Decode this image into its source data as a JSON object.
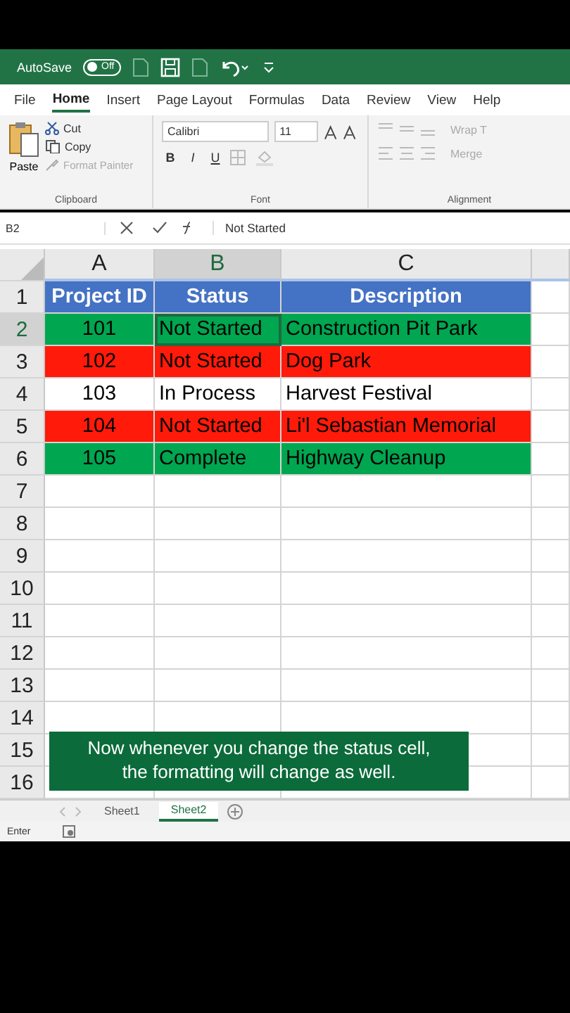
{
  "title_bar": {
    "autosave_label": "AutoSave",
    "toggle": {
      "label": "Off",
      "on": false
    }
  },
  "menu_tabs": [
    {
      "label": "File",
      "selected": false
    },
    {
      "label": "Home",
      "selected": true
    },
    {
      "label": "Insert",
      "selected": false
    },
    {
      "label": "Page Layout",
      "selected": false
    },
    {
      "label": "Formulas",
      "selected": false
    },
    {
      "label": "Data",
      "selected": false
    },
    {
      "label": "Review",
      "selected": false
    },
    {
      "label": "View",
      "selected": false
    },
    {
      "label": "Help",
      "selected": false
    }
  ],
  "ribbon": {
    "clipboard": {
      "paste": "Paste",
      "cut": "Cut",
      "copy": "Copy",
      "format_painter": "Format Painter",
      "group": "Clipboard"
    },
    "font": {
      "family": "Calibri",
      "size": "11",
      "bold": "B",
      "italic": "I",
      "underline": "U",
      "group": "Font"
    },
    "alignment": {
      "wrap": "Wrap T",
      "merge": "Merge",
      "group": "Alignment"
    }
  },
  "formula_bar": {
    "name_box": "B2",
    "content": "Not Started"
  },
  "columns": [
    {
      "label": "A",
      "selected": false
    },
    {
      "label": "B",
      "selected": true
    },
    {
      "label": "C",
      "selected": false
    }
  ],
  "rows": [
    {
      "number": "1",
      "selected": false,
      "kind": "header",
      "color": "#4472c4",
      "cells": [
        {
          "text": "Project ID",
          "selected": false
        },
        {
          "text": "Status",
          "selected": false
        },
        {
          "text": "Description",
          "selected": false
        }
      ]
    },
    {
      "number": "2",
      "selected": true,
      "kind": "data",
      "color": "#00a650",
      "cells": [
        {
          "text": "101",
          "selected": false
        },
        {
          "text": "Not Started",
          "selected": true
        },
        {
          "text": "Construction Pit Park",
          "selected": false
        }
      ]
    },
    {
      "number": "3",
      "selected": false,
      "kind": "data",
      "color": "#ff1a0a",
      "cells": [
        {
          "text": "102",
          "selected": false
        },
        {
          "text": "Not Started",
          "selected": false
        },
        {
          "text": "Dog Park",
          "selected": false
        }
      ]
    },
    {
      "number": "4",
      "selected": false,
      "kind": "data",
      "color": "#ffffff",
      "cells": [
        {
          "text": "103",
          "selected": false
        },
        {
          "text": "In Process",
          "selected": false
        },
        {
          "text": "Harvest Festival",
          "selected": false
        }
      ]
    },
    {
      "number": "5",
      "selected": false,
      "kind": "data",
      "color": "#ff1a0a",
      "cells": [
        {
          "text": "104",
          "selected": false
        },
        {
          "text": "Not Started",
          "selected": false
        },
        {
          "text": "Li'l Sebastian Memorial",
          "selected": false
        }
      ]
    },
    {
      "number": "6",
      "selected": false,
      "kind": "data",
      "color": "#00a650",
      "cells": [
        {
          "text": "105",
          "selected": false
        },
        {
          "text": "Complete",
          "selected": false
        },
        {
          "text": "Highway Cleanup",
          "selected": false
        }
      ]
    },
    {
      "number": "7"
    },
    {
      "number": "8"
    },
    {
      "number": "9"
    },
    {
      "number": "10"
    },
    {
      "number": "11"
    },
    {
      "number": "12"
    },
    {
      "number": "13"
    },
    {
      "number": "14"
    },
    {
      "number": "15"
    },
    {
      "number": "16"
    }
  ],
  "caption": "Now whenever you change the status cell, the formatting will change as well.",
  "sheet_tabs": [
    {
      "label": "Sheet1",
      "selected": false
    },
    {
      "label": "Sheet2",
      "selected": true
    }
  ],
  "status_bar": {
    "mode": "Enter"
  }
}
